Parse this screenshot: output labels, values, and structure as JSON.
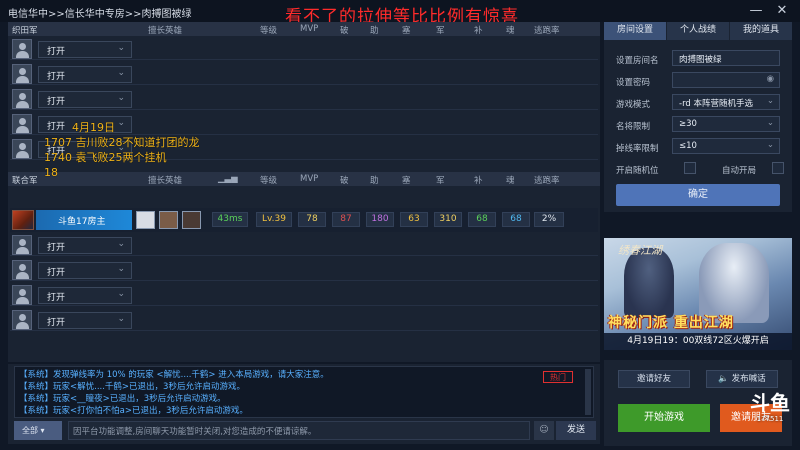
{
  "titlebar": {
    "path": "电信华中>>信长华中专房>>肉搏图被绿",
    "overlay_caption": "看不了的拉伸等比比例有惊喜",
    "min_icon": "minimize-icon",
    "close_icon": "close-icon"
  },
  "team_a": {
    "name": "织田军",
    "headers": [
      "擅长英雄",
      "等级",
      "MVP",
      "破",
      "助",
      "塞",
      "军",
      "补",
      "魂",
      "逃跑率"
    ],
    "slots": [
      "打开",
      "打开",
      "打开",
      "打开",
      "打开"
    ]
  },
  "team_b": {
    "name": "联合军",
    "headers": [
      "擅长英雄",
      "等级",
      "MVP",
      "破",
      "助",
      "塞",
      "军",
      "补",
      "魂",
      "逃跑率"
    ],
    "player": {
      "name": "斗鱼17房主",
      "ping": "43ms",
      "level": "Lv.39",
      "mvp": "78",
      "po": "87",
      "zhu": "180",
      "sai": "63",
      "jun": "310",
      "bu": "68",
      "hun": "68",
      "escape": "2%"
    },
    "slots": [
      "打开",
      "打开",
      "打开",
      "打开"
    ]
  },
  "danmu": [
    "4月19日",
    "1707 吉川败28不知道打团的龙",
    "1740 袁飞败25两个挂机",
    "18"
  ],
  "chat": {
    "lines": [
      "【系统】发现弹线率为 10% 的玩家 <解忧....千鹤> 进入本局游戏，请大家注意。",
      "【系统】玩家<解忧....千鹤>已退出，3秒后允许启动游戏。",
      "【系统】玩家<__瞳夜>已退出，3秒后允许启动游戏。",
      "【系统】玩家<打你怕不怕a>已退出，3秒后允许启动游戏。"
    ],
    "hot_tag": "热门",
    "channel": "全部",
    "input_placeholder": "因平台功能调整,房间聊天功能暂时关闭,对您造成的不便请谅解。",
    "send": "发送"
  },
  "room": {
    "tabs": [
      "房间设置",
      "个人战绩",
      "我的道具"
    ],
    "labels": {
      "name": "设置房间名",
      "password": "设置密码",
      "mode": "游戏模式",
      "fame": "名将限制",
      "drop": "掉线率限制",
      "random": "开启随机位",
      "auto": "自动开局"
    },
    "values": {
      "name": "肉搏图被绿",
      "password": "",
      "mode": "-rd 本阵营随机手选",
      "fame": "≥30",
      "drop": "≤10"
    },
    "confirm": "确定"
  },
  "banner": {
    "logo": "绣春江湖",
    "title": "神秘门派 重出江湖",
    "sub": "4月19日19：00双线72区火爆开启"
  },
  "actions": {
    "invite_friends": "邀请好友",
    "broadcast": "发布喊话",
    "start": "开始游戏",
    "invite": "邀请朋友"
  },
  "watermark": {
    "mark": "斗鱼",
    "room_id": "177511"
  },
  "colors": {
    "accent_red": "#ff2b2b",
    "danmu_yellow": "#f0b41a",
    "chat_blue": "#58b0ff",
    "start_green": "#3e9a2a",
    "invite_orange": "#e05a1e"
  }
}
